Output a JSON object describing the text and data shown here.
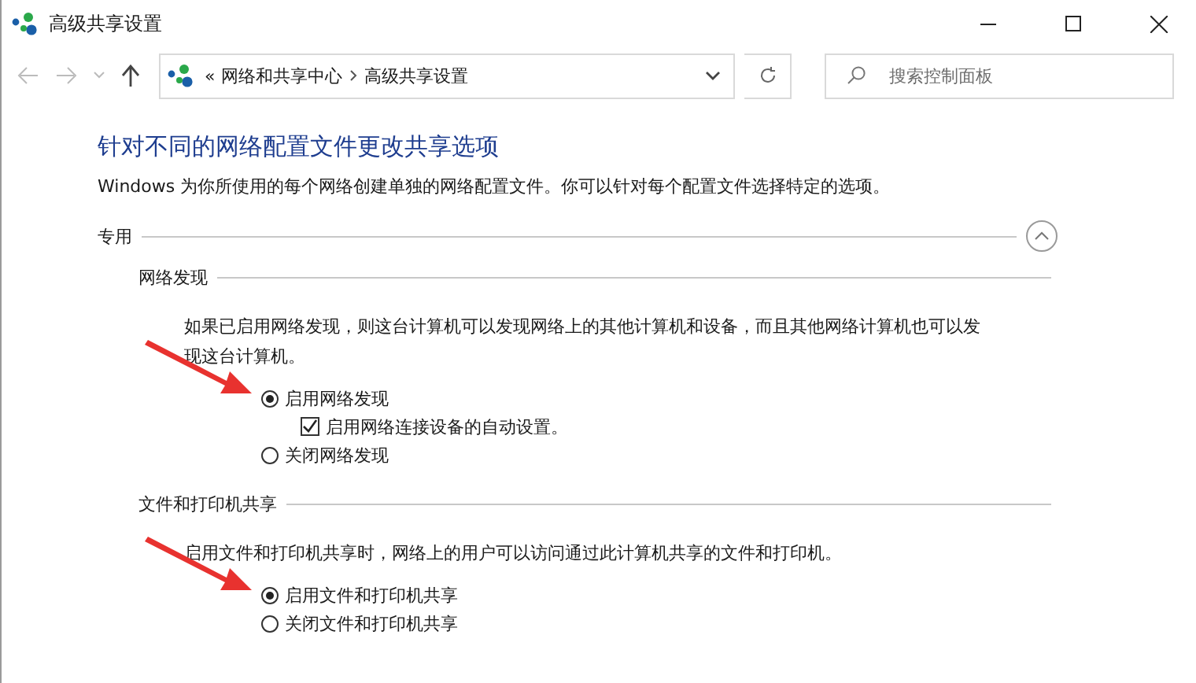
{
  "window": {
    "title": "高级共享设置"
  },
  "address_bar": {
    "overflow": "«",
    "crumbs": [
      "网络和共享中心",
      "高级共享设置"
    ]
  },
  "search": {
    "placeholder": "搜索控制面板"
  },
  "heading": "针对不同的网络配置文件更改共享选项",
  "intro": "Windows 为你所使用的每个网络创建单独的网络配置文件。你可以针对每个配置文件选择特定的选项。",
  "profile": {
    "label": "专用",
    "expanded": true,
    "sections": [
      {
        "title": "网络发现",
        "description": "如果已启用网络发现，则这台计算机可以发现网络上的其他计算机和设备，而且其他网络计算机也可以发现这台计算机。",
        "options": [
          {
            "kind": "radio",
            "label": "启用网络发现",
            "selected": true,
            "marked": true
          },
          {
            "kind": "checkbox",
            "label": "启用网络连接设备的自动设置。",
            "checked": true
          },
          {
            "kind": "radio",
            "label": "关闭网络发现",
            "selected": false,
            "marked": false
          }
        ]
      },
      {
        "title": "文件和打印机共享",
        "description": "启用文件和打印机共享时，网络上的用户可以访问通过此计算机共享的文件和打印机。",
        "options": [
          {
            "kind": "radio",
            "label": "启用文件和打印机共享",
            "selected": true,
            "marked": true
          },
          {
            "kind": "radio",
            "label": "关闭文件和打印机共享",
            "selected": false,
            "marked": false
          }
        ]
      }
    ]
  }
}
